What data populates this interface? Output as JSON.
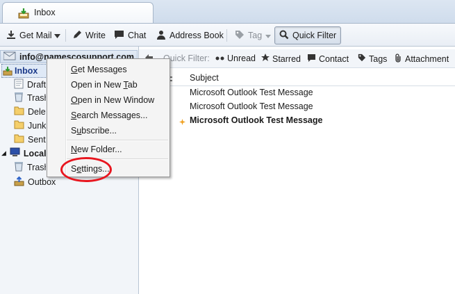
{
  "tabs": [
    {
      "label": "Inbox"
    }
  ],
  "toolbar": {
    "get_mail": "Get Mail",
    "write": "Write",
    "chat": "Chat",
    "address_book": "Address Book",
    "tag": "Tag",
    "quick_filter": "Quick Filter"
  },
  "folders": {
    "account": "info@namescosupport.com",
    "inbox": "Inbox",
    "drafts": "Drafts",
    "trash": "Trash",
    "deleted": "Deleted",
    "junk": "Junk",
    "sent": "Sent",
    "local": "Local Folders",
    "local_trash": "Trash",
    "outbox": "Outbox"
  },
  "filter_bar": {
    "label": "Quick Filter:",
    "unread": "Unread",
    "starred": "Starred",
    "contact": "Contact",
    "tags": "Tags",
    "attachment": "Attachment"
  },
  "columns": {
    "subject": "Subject"
  },
  "messages": [
    {
      "subject": "Microsoft Outlook Test Message",
      "unread": false
    },
    {
      "subject": "Microsoft Outlook Test Message",
      "unread": false
    },
    {
      "subject": "Microsoft Outlook Test Message",
      "unread": true
    }
  ],
  "context_menu": {
    "get_messages": {
      "u": "G",
      "rest": "et Messages"
    },
    "open_new_tab": {
      "pre": "Open in New ",
      "u": "T",
      "rest": "ab"
    },
    "open_new_window": {
      "u": "O",
      "rest": "pen in New Window"
    },
    "search_messages": {
      "u": "S",
      "rest": "earch Messages..."
    },
    "subscribe": {
      "pre": "S",
      "u": "u",
      "rest": "bscribe..."
    },
    "new_folder": {
      "u": "N",
      "rest": "ew Folder..."
    },
    "settings": {
      "pre": "S",
      "u": "e",
      "rest": "ttings..."
    }
  },
  "colors": {
    "highlight": "#e8161f",
    "accent": "#1b3a8a"
  }
}
